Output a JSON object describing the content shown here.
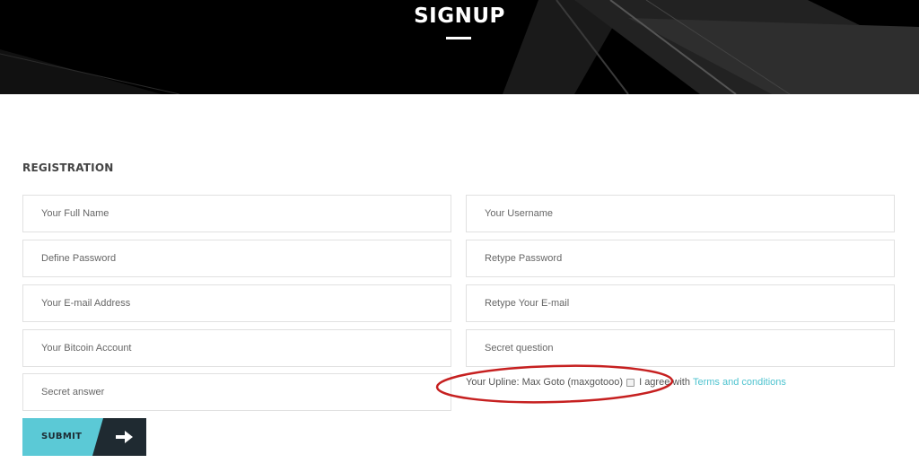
{
  "hero": {
    "title": "SIGNUP"
  },
  "form": {
    "section_title": "REGISTRATION",
    "fields": {
      "full_name": "Your Full Name",
      "username": "Your Username",
      "password": "Define Password",
      "retype_password": "Retype Password",
      "email": "Your E-mail Address",
      "retype_email": "Retype Your E-mail",
      "bitcoin_account": "Your Bitcoin Account",
      "secret_question": "Secret question",
      "secret_answer": "Secret answer"
    },
    "upline": "Your Upline: Max Goto (maxgotooo)",
    "agree_text": "I agree with",
    "terms_link": "Terms and conditions",
    "submit_label": "SUBMIT"
  },
  "colors": {
    "accent": "#5bc9d6",
    "dark": "#1f2a31",
    "link": "#4ec3cf",
    "annotation": "#c62020"
  }
}
